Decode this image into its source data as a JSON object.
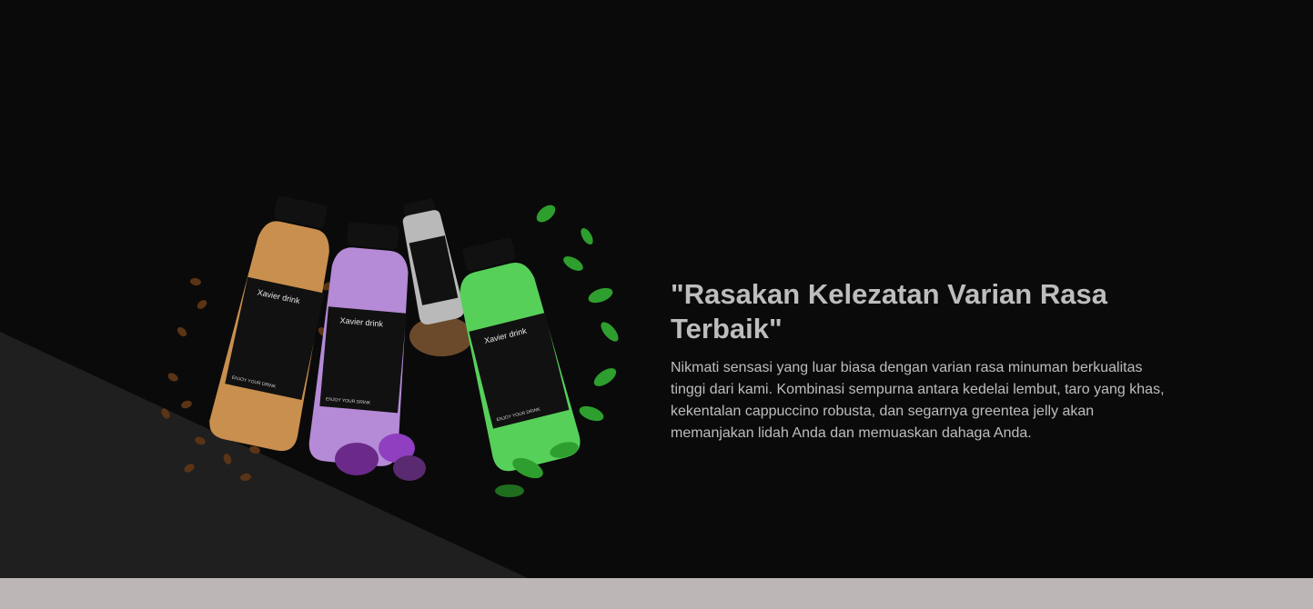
{
  "hero": {
    "headline": "\"Rasakan Kelezatan Varian Rasa Terbaik\"",
    "description": "Nikmati sensasi yang luar biasa dengan varian rasa minuman berkualitas tinggi dari kami. Kombinasi sempurna antara kedelai lembut, taro yang khas, kekentalan cappuccino robusta, dan segarnya greentea jelly akan memanjakan lidah Anda dan memuaskan dahaga Anda."
  },
  "product_image": {
    "brand": "Xavier drink",
    "label_footer": "ENJOY YOUR DRINK",
    "bottles": [
      {
        "flavor": "cappuccino",
        "color": "#c98f4e"
      },
      {
        "flavor": "taro",
        "color": "#b58ad6"
      },
      {
        "flavor": "soy milk",
        "color": "#b9b9b9"
      },
      {
        "flavor": "greentea jelly",
        "color": "#57d05a"
      }
    ]
  },
  "colors": {
    "background": "#0a0a0a",
    "diagonal_panel": "#1f1f1f",
    "footer_band": "#bcb7b6",
    "text": "#bdbdbd"
  }
}
